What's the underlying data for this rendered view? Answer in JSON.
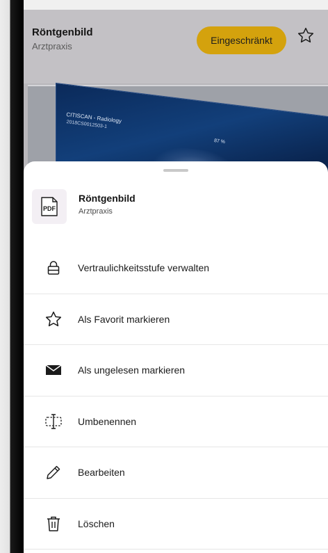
{
  "header": {
    "title": "Röntgenbild",
    "subtitle": "Arztpraxis",
    "badge_label": "Eingeschränkt",
    "favorite_icon": "star-outline-icon"
  },
  "preview": {
    "scan_title": "CITISCAN - Radiology",
    "scan_id": "2018CS0012503-1",
    "scan_percent": "87 %"
  },
  "sheet": {
    "file_type": "PDF",
    "title": "Röntgenbild",
    "subtitle": "Arztpraxis",
    "items": [
      {
        "label": "Vertraulichkeitsstufe verwalten",
        "icon": "lock-icon"
      },
      {
        "label": "Als Favorit markieren",
        "icon": "star-icon"
      },
      {
        "label": "Als ungelesen markieren",
        "icon": "envelope-icon"
      },
      {
        "label": "Umbenennen",
        "icon": "rename-icon"
      },
      {
        "label": "Bearbeiten",
        "icon": "pencil-icon"
      },
      {
        "label": "Löschen",
        "icon": "trash-icon"
      }
    ]
  },
  "colors": {
    "badge": "#d4a20d",
    "backdrop": "#b9b7bb",
    "sheet": "#ffffff"
  }
}
